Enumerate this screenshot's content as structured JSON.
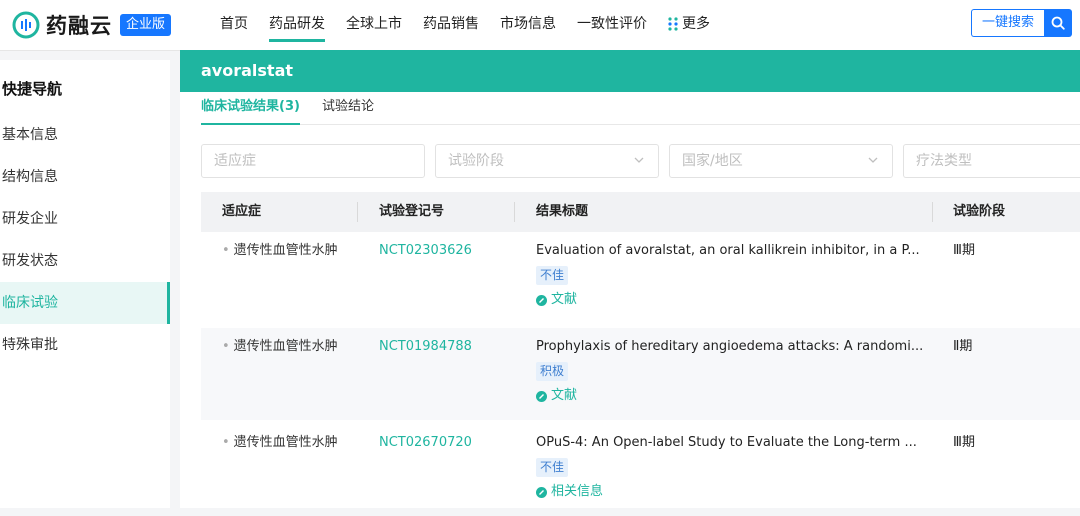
{
  "brand": {
    "name": "药融云",
    "badge": "企业版"
  },
  "nav": [
    "首页",
    "药品研发",
    "全球上市",
    "药品销售",
    "市场信息",
    "一致性评价",
    "更多"
  ],
  "search": {
    "button_label": "一键搜索"
  },
  "sidebar": {
    "title": "快捷导航",
    "items": [
      "基本信息",
      "结构信息",
      "研发企业",
      "研发状态",
      "临床试验",
      "特殊审批"
    ],
    "active": "临床试验"
  },
  "drug": {
    "name": "avoralstat"
  },
  "tabs": [
    "临床试验结果(3)",
    "试验结论"
  ],
  "filters": {
    "indication": "适应症",
    "phase": "试验阶段",
    "country": "国家/地区",
    "therapy": "疗法类型"
  },
  "table": {
    "columns": [
      "适应症",
      "试验登记号",
      "结果标题",
      "试验阶段"
    ],
    "rows": [
      {
        "indication": "遗传性血管性水肿",
        "nct": "NCT02303626",
        "title": "Evaluation of avoralstat, an oral kallikrein inhibitor, in a P...",
        "tag": "不佳",
        "link": "文献",
        "phase": "Ⅲ期"
      },
      {
        "indication": "遗传性血管性水肿",
        "nct": "NCT01984788",
        "title": "Prophylaxis of hereditary angioedema attacks: A randomi...",
        "tag": "积极",
        "link": "文献",
        "phase": "Ⅱ期"
      },
      {
        "indication": "遗传性血管性水肿",
        "nct": "NCT02670720",
        "title": "OPuS-4: An Open-label Study to Evaluate the Long-term ...",
        "tag": "不佳",
        "link": "相关信息",
        "phase": "Ⅲ期"
      }
    ]
  },
  "colors": {
    "accent": "#1fb5a0",
    "brand_blue": "#1677ff",
    "tag_bg": "#e6f0fb",
    "tag_text": "#3f7fd0"
  }
}
